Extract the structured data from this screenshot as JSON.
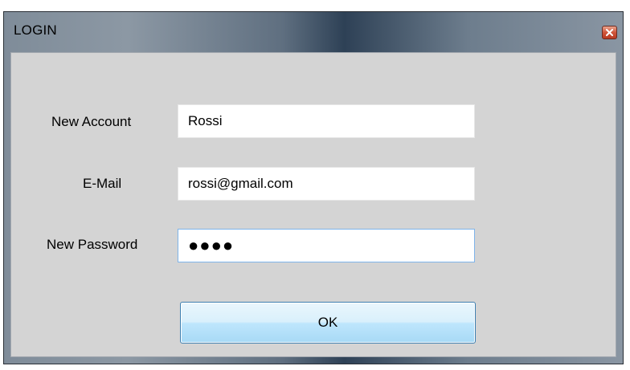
{
  "window": {
    "title": "LOGIN"
  },
  "form": {
    "account_label": "New Account",
    "account_value": "Rossi",
    "email_label": "E-Mail",
    "email_value": "rossi@gmail.com",
    "password_label": "New Password",
    "password_value": "●●●●"
  },
  "buttons": {
    "ok_label": "OK",
    "close_icon": "close-icon"
  }
}
